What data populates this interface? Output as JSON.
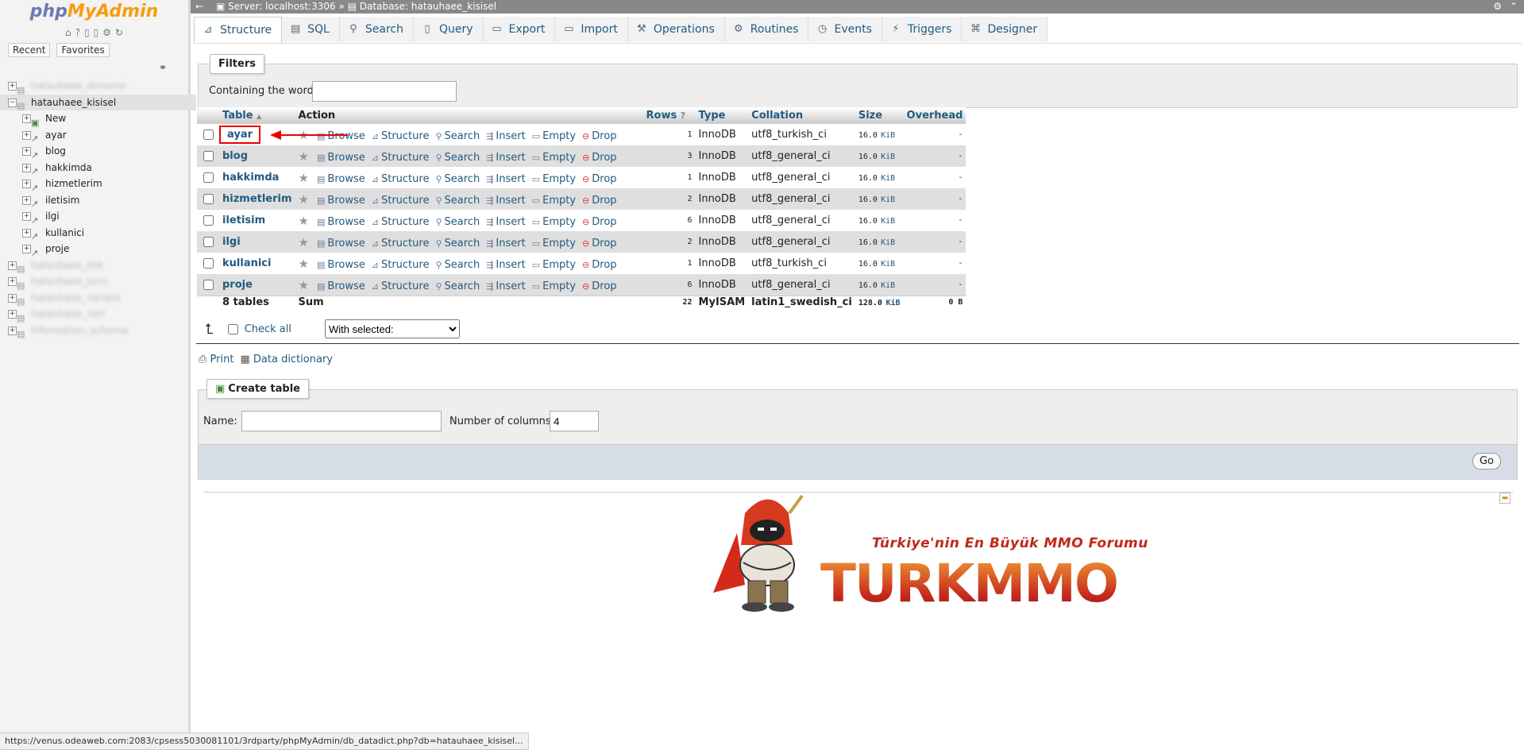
{
  "nav": {
    "logo_part1": "php",
    "logo_part2": "MyAdmin",
    "tab_recent": "Recent",
    "tab_favorites": "Favorites",
    "tree": [
      {
        "label": "hatauhaee_deneme",
        "blurred": true,
        "level": 0
      },
      {
        "label": "hatauhaee_kisisel",
        "blurred": false,
        "level": 0,
        "expanded": true
      },
      {
        "label": "New",
        "blurred": false,
        "level": 1
      },
      {
        "label": "ayar",
        "blurred": false,
        "level": 1
      },
      {
        "label": "blog",
        "blurred": false,
        "level": 1
      },
      {
        "label": "hakkimda",
        "blurred": false,
        "level": 1
      },
      {
        "label": "hizmetlerim",
        "blurred": false,
        "level": 1
      },
      {
        "label": "iletisim",
        "blurred": false,
        "level": 1
      },
      {
        "label": "ilgi",
        "blurred": false,
        "level": 1
      },
      {
        "label": "kullanici",
        "blurred": false,
        "level": 1
      },
      {
        "label": "proje",
        "blurred": false,
        "level": 1
      },
      {
        "label": "hatauhaee_link",
        "blurred": true,
        "level": 0
      },
      {
        "label": "hatauhaee_soru",
        "blurred": true,
        "level": 0
      },
      {
        "label": "hatauhaee_varlent",
        "blurred": true,
        "level": 0
      },
      {
        "label": "hatauhaee_veri",
        "blurred": true,
        "level": 0
      },
      {
        "label": "information_schema",
        "blurred": true,
        "level": 0
      }
    ]
  },
  "topbar": {
    "server": "Server: localhost:3306",
    "sep": "»",
    "database": "Database: hatauhaee_kisisel"
  },
  "tabs": [
    {
      "label": "Structure",
      "icon": "structure-icon",
      "active": true
    },
    {
      "label": "SQL",
      "icon": "sql-icon"
    },
    {
      "label": "Search",
      "icon": "search-icon"
    },
    {
      "label": "Query",
      "icon": "query-icon"
    },
    {
      "label": "Export",
      "icon": "export-icon"
    },
    {
      "label": "Import",
      "icon": "import-icon"
    },
    {
      "label": "Operations",
      "icon": "operations-icon"
    },
    {
      "label": "Routines",
      "icon": "routines-icon"
    },
    {
      "label": "Events",
      "icon": "events-icon"
    },
    {
      "label": "Triggers",
      "icon": "triggers-icon"
    },
    {
      "label": "Designer",
      "icon": "designer-icon"
    }
  ],
  "filters": {
    "legend": "Filters",
    "label": "Containing the word:",
    "value": ""
  },
  "table": {
    "headers": {
      "table": "Table",
      "sort_indicator": "▲",
      "action": "Action",
      "rows": "Rows",
      "type": "Type",
      "collation": "Collation",
      "size": "Size",
      "overhead": "Overhead"
    },
    "actions": [
      "Browse",
      "Structure",
      "Search",
      "Insert",
      "Empty",
      "Drop"
    ],
    "rows": [
      {
        "name": "ayar",
        "rows": "1",
        "type": "InnoDB",
        "collation": "utf8_turkish_ci",
        "size": "16.0",
        "unit": "KiB",
        "overhead": "-",
        "highlighted": true
      },
      {
        "name": "blog",
        "rows": "3",
        "type": "InnoDB",
        "collation": "utf8_general_ci",
        "size": "16.0",
        "unit": "KiB",
        "overhead": "-"
      },
      {
        "name": "hakkimda",
        "rows": "1",
        "type": "InnoDB",
        "collation": "utf8_general_ci",
        "size": "16.0",
        "unit": "KiB",
        "overhead": "-"
      },
      {
        "name": "hizmetlerim",
        "rows": "2",
        "type": "InnoDB",
        "collation": "utf8_general_ci",
        "size": "16.0",
        "unit": "KiB",
        "overhead": "-"
      },
      {
        "name": "iletisim",
        "rows": "6",
        "type": "InnoDB",
        "collation": "utf8_general_ci",
        "size": "16.0",
        "unit": "KiB",
        "overhead": "-"
      },
      {
        "name": "ilgi",
        "rows": "2",
        "type": "InnoDB",
        "collation": "utf8_general_ci",
        "size": "16.0",
        "unit": "KiB",
        "overhead": "-"
      },
      {
        "name": "kullanici",
        "rows": "1",
        "type": "InnoDB",
        "collation": "utf8_turkish_ci",
        "size": "16.0",
        "unit": "KiB",
        "overhead": "-"
      },
      {
        "name": "proje",
        "rows": "6",
        "type": "InnoDB",
        "collation": "utf8_general_ci",
        "size": "16.0",
        "unit": "KiB",
        "overhead": "-"
      }
    ],
    "summary": {
      "tables": "8 tables",
      "sum": "Sum",
      "rows": "22",
      "type": "MyISAM",
      "collation": "latin1_swedish_ci",
      "size": "128.0",
      "unit": "KiB",
      "overhead": "0 B"
    }
  },
  "bulk": {
    "check_all": "Check all",
    "with_selected": "With selected:"
  },
  "links": {
    "print": "Print",
    "data_dictionary": "Data dictionary"
  },
  "create_table": {
    "legend": "Create table",
    "name_label": "Name:",
    "name_value": "",
    "columns_label": "Number of columns:",
    "columns_value": "4",
    "go": "Go"
  },
  "banner": {
    "slogan": "Türkiye'nin En Büyük MMO Forumu",
    "wordmark": "TURKMMO"
  },
  "status_url": "https://venus.odeaweb.com:2083/cpsess5030081101/3rdparty/phpMyAdmin/db_datadict.php?db=hatauhaee_kisisel...",
  "colors": {
    "link": "#235a81",
    "highlight": "#e00000",
    "logo_blue": "#6c78af",
    "logo_orange": "#f89c0e"
  }
}
